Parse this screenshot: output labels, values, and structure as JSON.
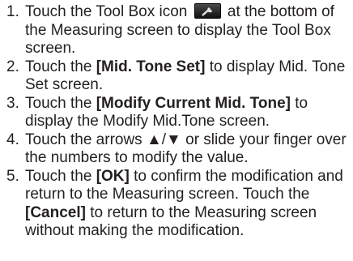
{
  "steps": [
    {
      "num": "1.",
      "text_before": "Touch the Tool Box icon",
      "icon": "wrench-icon",
      "text_after": "at the bottom of the Measuring screen to display the Tool Box screen."
    },
    {
      "num": "2.",
      "text_before": "Touch the",
      "bold": "[Mid. Tone Set]",
      "text_after": "to display Mid. Tone Set screen."
    },
    {
      "num": "3.",
      "text_before": "Touch the",
      "bold": "[Modify Current Mid. Tone]",
      "text_after": "to display the Modify Mid.Tone screen."
    },
    {
      "num": "4.",
      "text": "Touch the arrows ▲/▼ or slide your finger over the numbers to modify the value."
    },
    {
      "num": "5.",
      "text_before": "Touch the",
      "bold": "[OK]",
      "text_middle": "to confirm the modification and return to the Measuring screen. Touch the",
      "bold2": "[Cancel]",
      "text_after": "to return to the Measuring screen without making the modification."
    }
  ]
}
